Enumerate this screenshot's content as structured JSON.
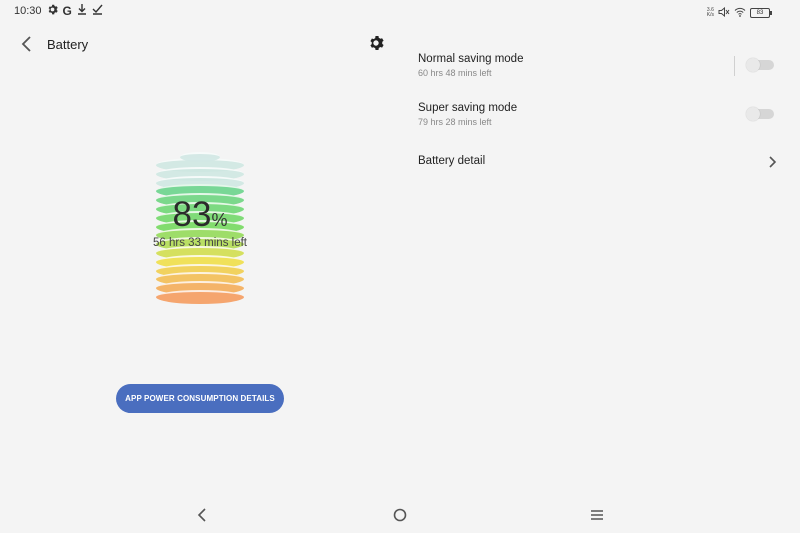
{
  "status_bar": {
    "time": "10:30",
    "icons_left": [
      "settings-icon",
      "google-icon",
      "download-icon",
      "check-icon"
    ],
    "network_speed_top": "3.6",
    "network_speed_bottom": "K/s",
    "battery_level": "83",
    "icons_right": [
      "network-speed",
      "mute-icon",
      "wifi-icon",
      "battery-icon"
    ]
  },
  "header": {
    "title": "Battery"
  },
  "battery": {
    "percent": "83",
    "percent_sign": "%",
    "time_left": "56 hrs 33 mins left",
    "level": 0.83
  },
  "actions": {
    "app_power_label": "APP POWER CONSUMPTION DETAILS"
  },
  "settings": {
    "normal_saving": {
      "title": "Normal saving mode",
      "subtitle": "60 hrs 48 mins left",
      "enabled": false
    },
    "super_saving": {
      "title": "Super saving mode",
      "subtitle": "79 hrs 28 mins left",
      "enabled": false
    },
    "battery_detail": {
      "title": "Battery detail"
    }
  },
  "colors": {
    "background": "#f4f4f4",
    "button": "#4a6ebf",
    "toggle_off": "#d6d6d6"
  },
  "navigation": {
    "icons": [
      "back-icon",
      "home-icon",
      "menu-icon"
    ]
  }
}
